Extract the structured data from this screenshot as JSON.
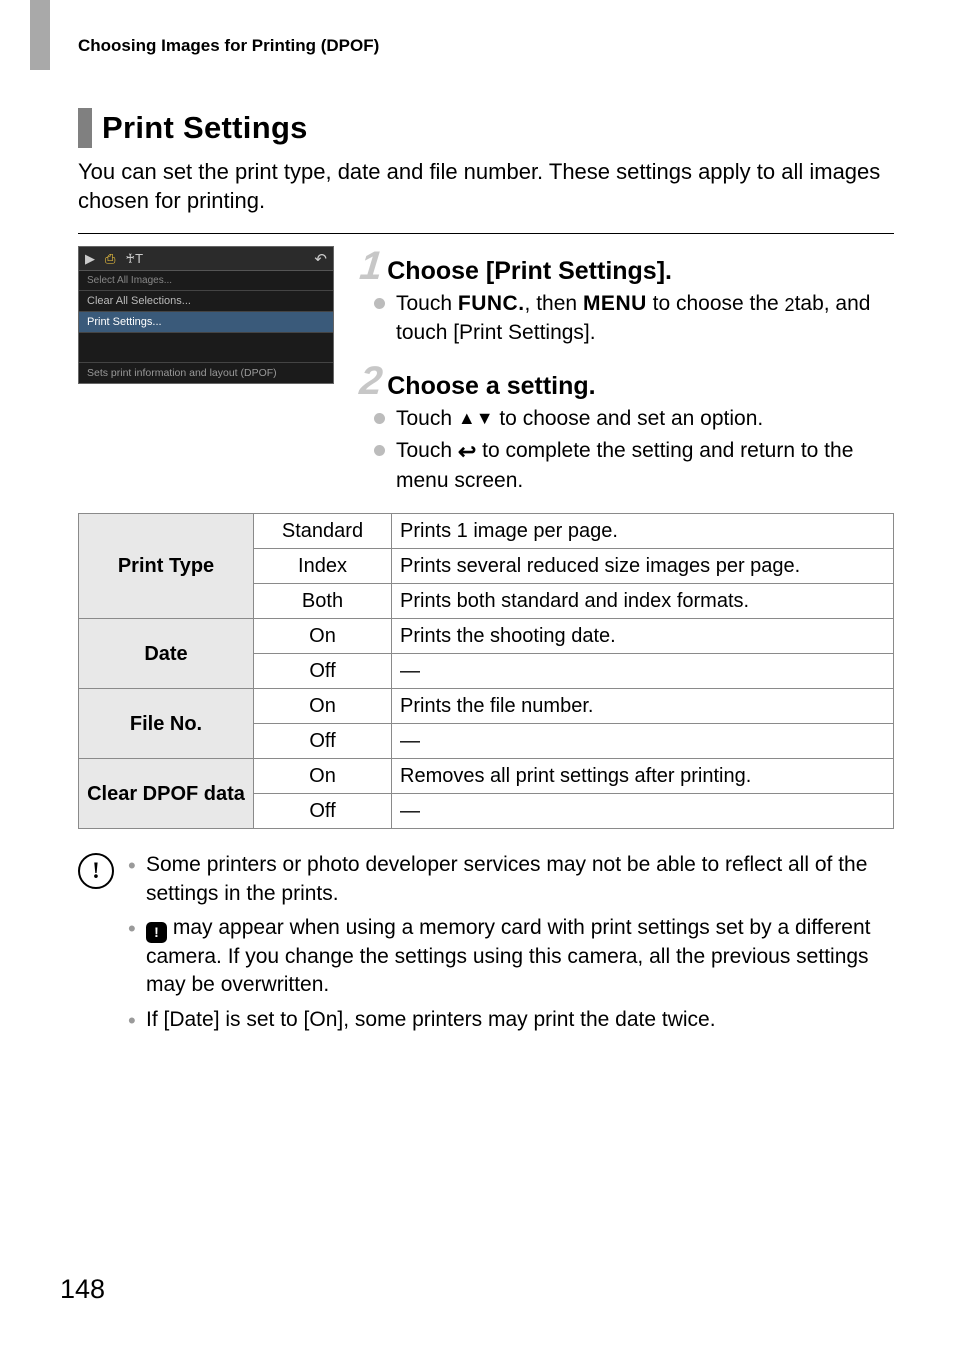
{
  "running_header": "Choosing Images for Printing (DPOF)",
  "section_title": "Print Settings",
  "intro": "You can set the print type, date and file number. These settings apply to all images chosen for printing.",
  "screenshot": {
    "row_dim": "Select All Images...",
    "row_clear": "Clear All Selections...",
    "row_sel": "Print Settings...",
    "footer": "Sets print information and layout (DPOF)"
  },
  "steps": [
    {
      "num": "1",
      "title": "Choose [Print Settings].",
      "bullets": [
        {
          "pre": "Touch ",
          "fn1": "FUNC.",
          "mid1": ", then ",
          "fn2": "MENU",
          "mid2": " to choose the ",
          "glyph": "2 ",
          "post": "tab, and touch [Print Settings]."
        }
      ]
    },
    {
      "num": "2",
      "title": "Choose a setting.",
      "bullets": [
        {
          "pre": "Touch ",
          "tri": "▲▼",
          "post": " to choose and set an option."
        },
        {
          "pre": "Touch ",
          "undo": "↩",
          "post": " to complete the setting and return to the menu screen."
        }
      ]
    }
  ],
  "table": {
    "rows": [
      {
        "label": "Print Type",
        "opts": [
          {
            "name": "Standard",
            "desc": "Prints 1 image per page."
          },
          {
            "name": "Index",
            "desc": "Prints several reduced size images per page."
          },
          {
            "name": "Both",
            "desc": "Prints both standard and index formats."
          }
        ]
      },
      {
        "label": "Date",
        "opts": [
          {
            "name": "On",
            "desc": "Prints the shooting date."
          },
          {
            "name": "Off",
            "desc": "—"
          }
        ]
      },
      {
        "label": "File No.",
        "opts": [
          {
            "name": "On",
            "desc": "Prints the file number."
          },
          {
            "name": "Off",
            "desc": "—"
          }
        ]
      },
      {
        "label": "Clear DPOF data",
        "opts": [
          {
            "name": "On",
            "desc": "Removes all print settings after printing."
          },
          {
            "name": "Off",
            "desc": "—"
          }
        ]
      }
    ]
  },
  "cautions": [
    "Some printers or photo developer services may not be able to reflect all of the settings in the prints.",
    " may appear when using a memory card with print settings set by a different camera. If you change the settings using this camera, all the previous settings may be overwritten.",
    "If [Date] is set to [On], some printers may print the date twice."
  ],
  "caution_icon_text": "!",
  "page_number": "148"
}
